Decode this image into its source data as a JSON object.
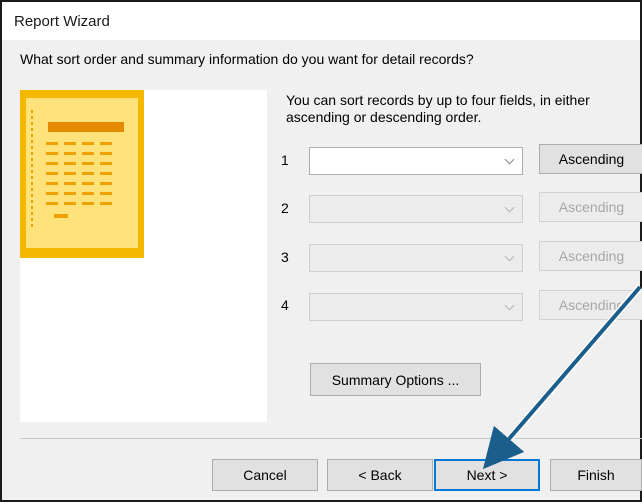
{
  "window": {
    "title": "Report Wizard"
  },
  "question": "What sort order and summary information do you want for detail records?",
  "instructions": "You can sort records by up to four fields, in either ascending or descending order.",
  "sort_rows": [
    {
      "number": "1",
      "field_value": "",
      "order_label": "Ascending",
      "enabled": true
    },
    {
      "number": "2",
      "field_value": "",
      "order_label": "Ascending",
      "enabled": false
    },
    {
      "number": "3",
      "field_value": "",
      "order_label": "Ascending",
      "enabled": false
    },
    {
      "number": "4",
      "field_value": "",
      "order_label": "Ascending",
      "enabled": false
    }
  ],
  "summary_options_label": "Summary Options ...",
  "footer": {
    "cancel_label": "Cancel",
    "back_label": "< Back",
    "next_label": "Next >",
    "finish_label": "Finish"
  },
  "colors": {
    "preview_tile": "#f5b800",
    "annotation_arrow": "#1b5e8c",
    "default_button_border": "#0078d7"
  },
  "icons": {
    "report_preview": "report-preview-icon",
    "dropdown": "chevron-down-icon",
    "annotation": "arrow-annotation-icon"
  }
}
